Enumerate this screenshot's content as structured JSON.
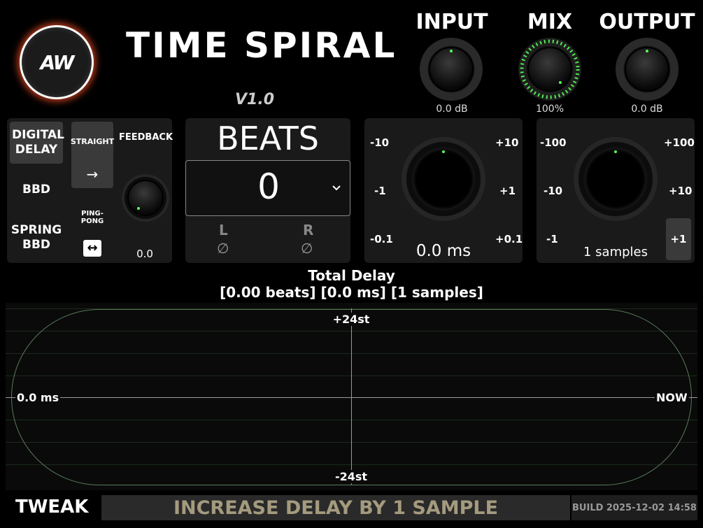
{
  "app": {
    "logo_text": "AW",
    "title": "TIME SPIRAL",
    "version": "V1.0"
  },
  "knobs": [
    {
      "label": "INPUT",
      "value": "0.0 dB",
      "active": false
    },
    {
      "label": "MIX",
      "value": "100%",
      "active": true
    },
    {
      "label": "OUTPUT",
      "value": "0.0 dB",
      "active": false
    }
  ],
  "mode": {
    "digital_delay": "DIGITAL DELAY",
    "bbd": "BBD",
    "spring_bbd": "SPRING BBD",
    "straight": "STRAIGHT",
    "straight_icon": "→",
    "ping_pong": "PING-PONG",
    "ping_pong_icon": "↔",
    "feedback_label": "FEEDBACK",
    "feedback_value": "0.0"
  },
  "beats": {
    "label": "BEATS",
    "value": "0",
    "dropdown_icon": "chevron-down",
    "left_label": "L",
    "right_label": "R",
    "phase_symbol": "∅"
  },
  "ms_panel": {
    "labels_left": [
      "-10",
      "-1",
      "-0.1"
    ],
    "labels_right": [
      "+10",
      "+1",
      "+0.1"
    ],
    "value": "0.0 ms"
  },
  "samples_panel": {
    "labels_left": [
      "-100",
      "-10",
      "-1"
    ],
    "labels_right": [
      "+100",
      "+10",
      "+1"
    ],
    "value": "1 samples"
  },
  "total": {
    "title": "Total Delay",
    "summary": "[0.00 beats] [0.0 ms] [1 samples]"
  },
  "graph": {
    "top_label": "+24st",
    "bottom_label": "-24st",
    "left_label": "0.0 ms",
    "right_label": "NOW"
  },
  "footer": {
    "tweak": "TWEAK",
    "status": "INCREASE DELAY BY 1 SAMPLE",
    "build": "BUILD 2025-12-02 14:58"
  },
  "colors": {
    "accent_green": "#55ff55",
    "logo_glow": "#ff5028",
    "panel": "#1a1a1a"
  }
}
